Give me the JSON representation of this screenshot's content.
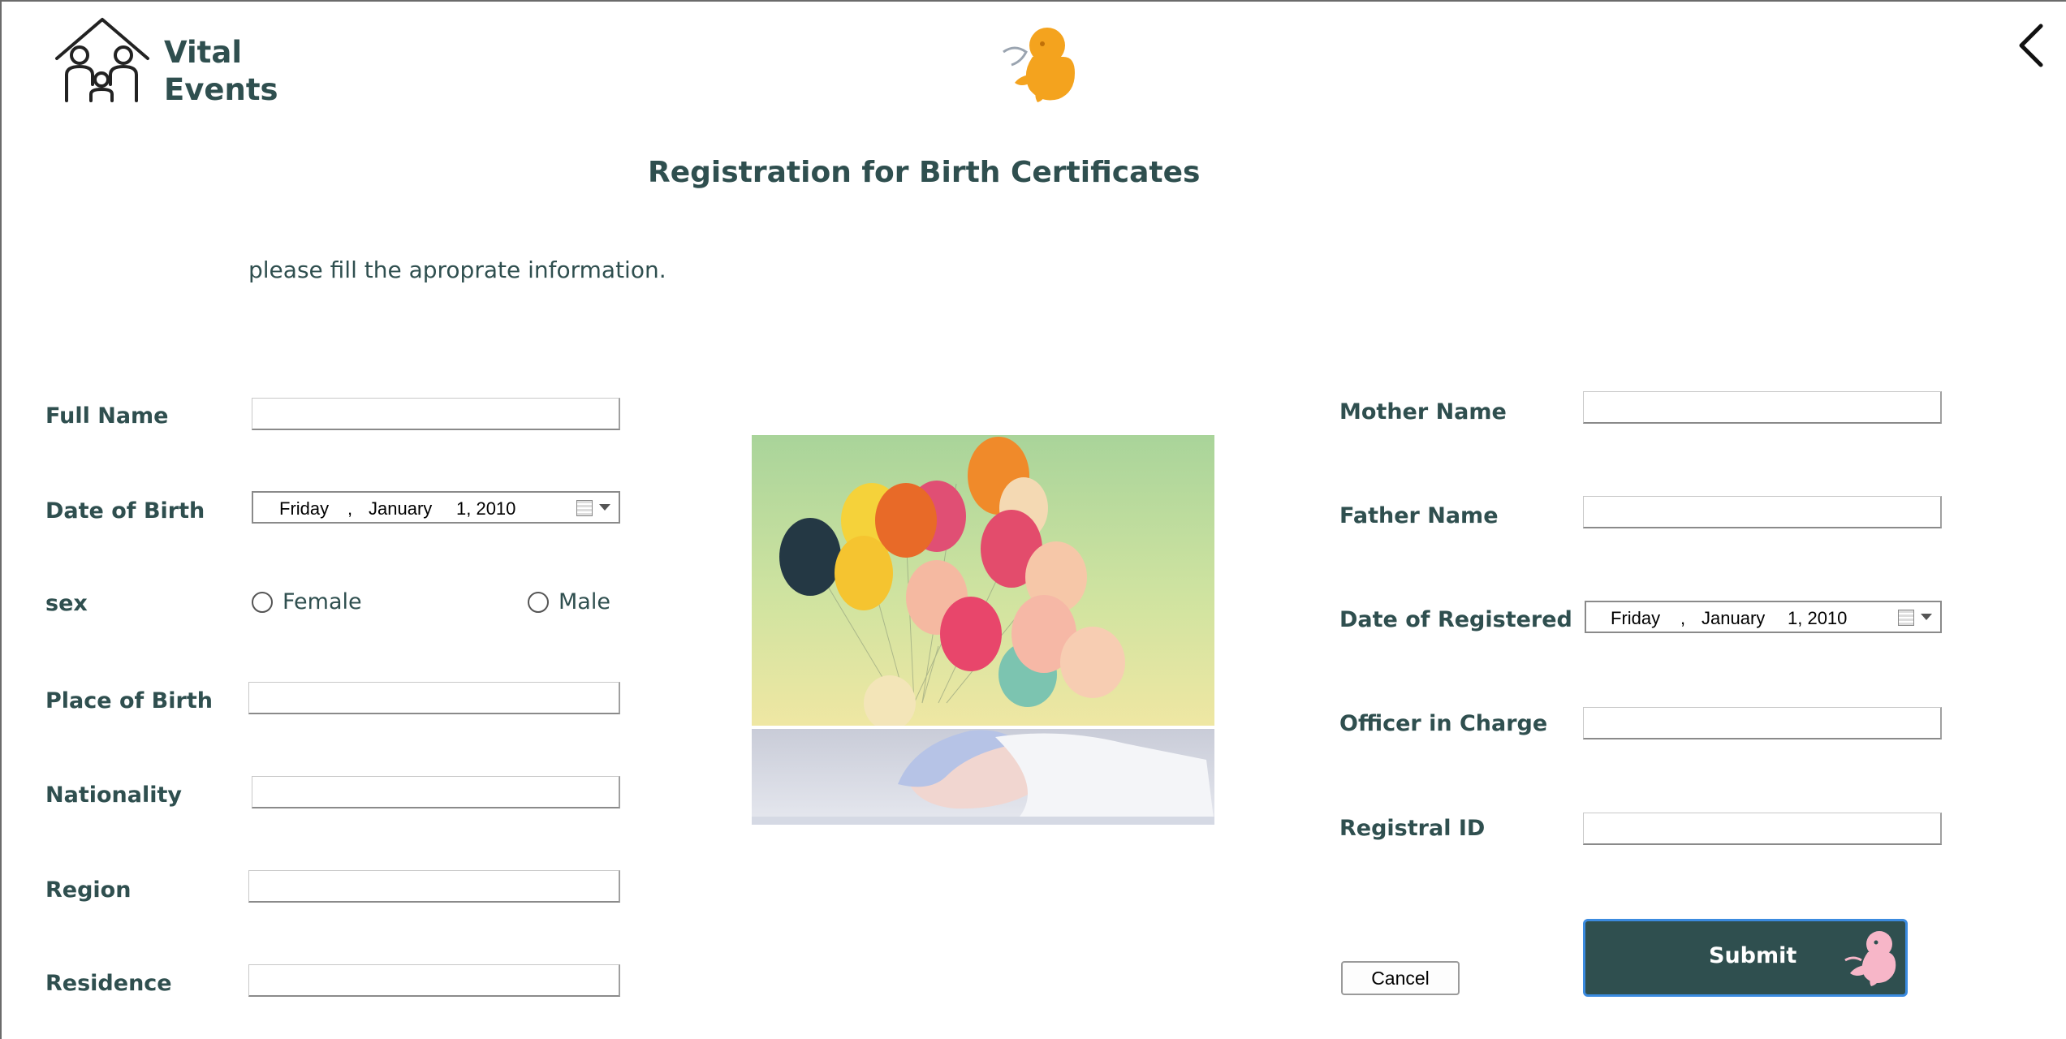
{
  "app": {
    "brand_line1": "Vital",
    "brand_line2": "Events"
  },
  "page": {
    "title": "Registration for Birth Certificates",
    "subtitle": "please fill the aproprate information."
  },
  "left_form": {
    "full_name_label": "Full Name",
    "full_name_value": "",
    "dob_label": "Date of Birth",
    "dob": {
      "weekday": "Friday",
      "sep": ",",
      "month": "January",
      "day_year": "1, 2010"
    },
    "sex_label": "sex",
    "sex_options": [
      "Female",
      "Male"
    ],
    "place_of_birth_label": "Place of Birth",
    "place_of_birth_value": "",
    "nationality_label": "Nationality",
    "nationality_value": "",
    "region_label": "Region",
    "region_value": "",
    "residence_label": "Residence",
    "residence_value": ""
  },
  "right_form": {
    "mother_name_label": "Mother Name",
    "mother_name_value": "",
    "father_name_label": "Father Name",
    "father_name_value": "",
    "date_registered_label": "Date of Registered",
    "date_registered": {
      "weekday": "Friday",
      "sep": ",",
      "month": "January",
      "day_year": "1, 2010"
    },
    "officer_label": "Officer in Charge",
    "officer_value": "",
    "registral_id_label": "Registral ID",
    "registral_id_value": ""
  },
  "buttons": {
    "cancel": "Cancel",
    "submit": "Submit"
  },
  "icons": {
    "logo": "family-house-icon",
    "header": "fetus-icon",
    "back": "chevron-left-icon",
    "submit": "fetus-icon"
  },
  "colors": {
    "primary_text": "#2f4f4f",
    "submit_bg": "#2f4f4f",
    "submit_focus": "#3b8be0",
    "fetus_orange": "#f4a31e",
    "fetus_pink": "#f7b6c8"
  }
}
